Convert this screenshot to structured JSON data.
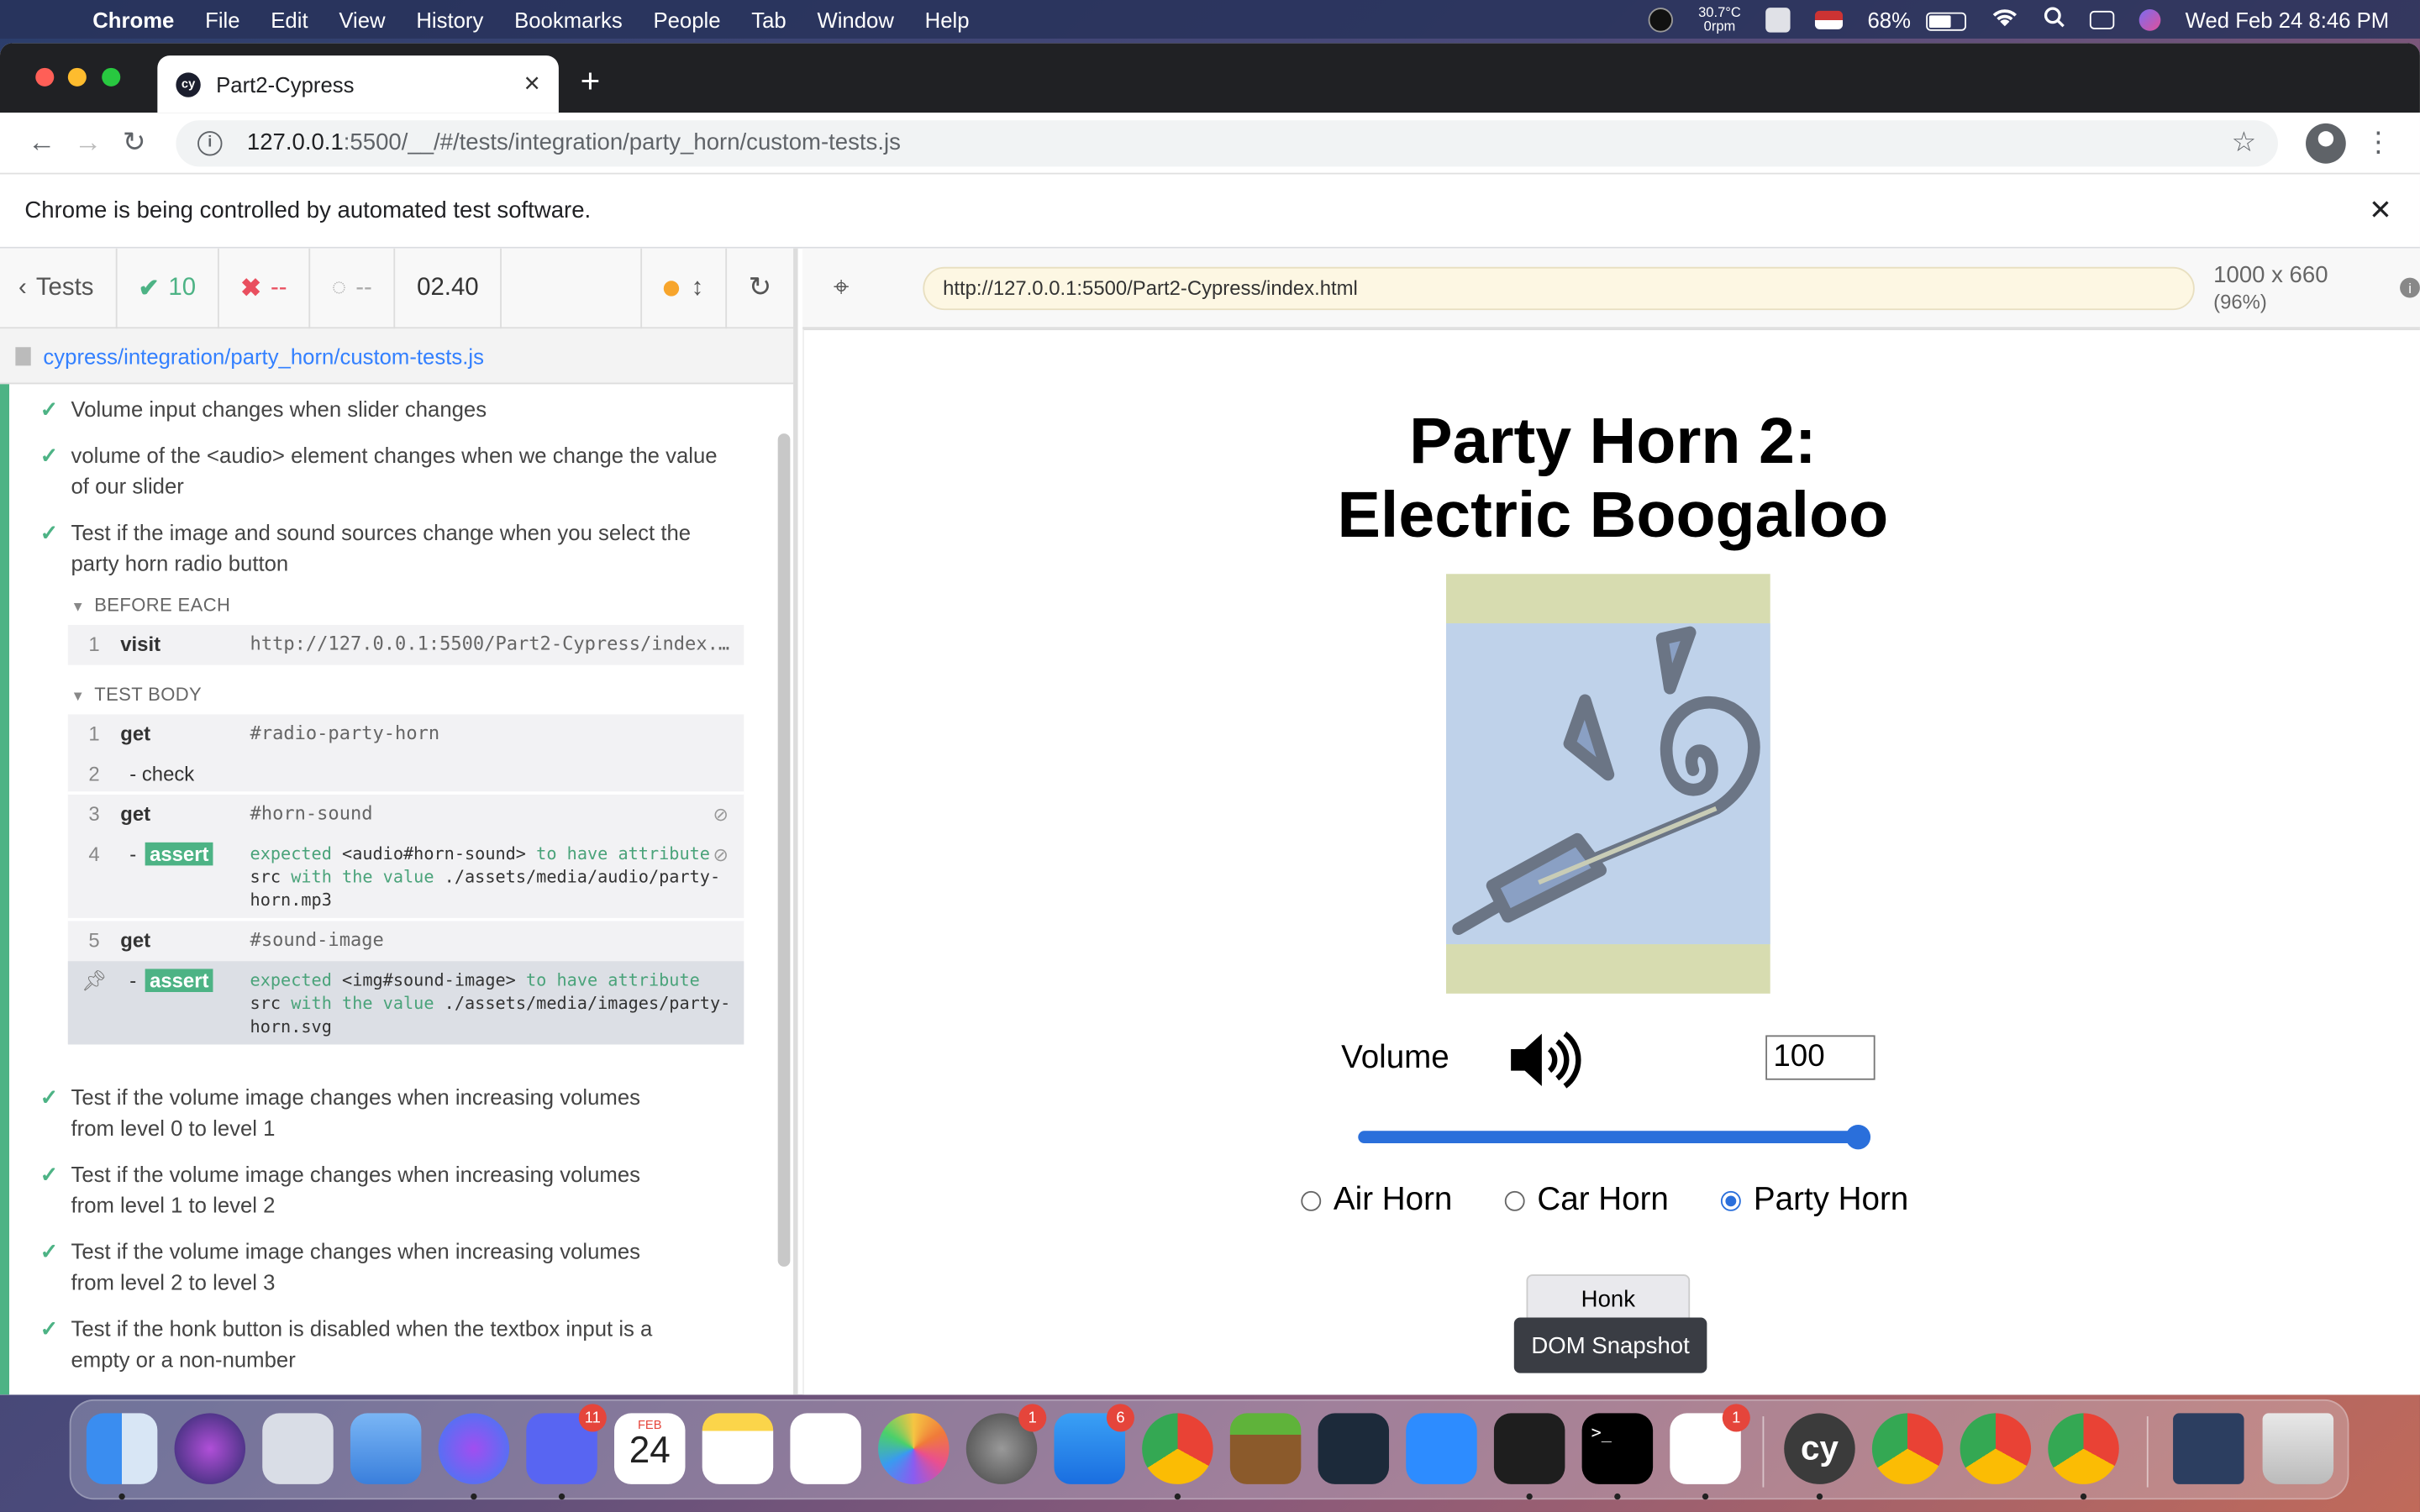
{
  "menubar": {
    "app": "Chrome",
    "items": [
      "File",
      "Edit",
      "View",
      "History",
      "Bookmarks",
      "People",
      "Tab",
      "Window",
      "Help"
    ],
    "temp": "30.7°C",
    "rpm": "0rpm",
    "battery": "68%",
    "battery_level": 0.68,
    "datetime": "Wed Feb 24  8:46 PM"
  },
  "browser": {
    "tab_title": "Part2-Cypress",
    "favicon_text": "cy",
    "url_host": "127.0.0.1",
    "url_rest": ":5500/__/#/tests/integration/party_horn/custom-tests.js",
    "infobar_text": "Chrome is being controlled by automated test software."
  },
  "cypress": {
    "back_label": "Tests",
    "passed": "10",
    "failed": "--",
    "pending": "--",
    "duration": "02.40",
    "spec_path": "cypress/integration/party_horn/custom-tests.js",
    "aut_url": "http://127.0.0.1:5500/Part2-Cypress/index.html",
    "viewport": "1000 x 660",
    "viewport_pct": "(96%)",
    "tests_before": [
      "Volume input changes when slider changes",
      "volume of the <audio> element changes when we change the value of our slider",
      "Test if the image and sound sources change when you select the party horn radio button"
    ],
    "before_each_label": "BEFORE EACH",
    "before_each_cmd": {
      "num": "1",
      "name": "visit",
      "msg": "http://127.0.0.1:5500/Part2-Cypress/index.html"
    },
    "test_body_label": "TEST BODY",
    "cmds": {
      "c1": {
        "num": "1",
        "name": "get",
        "msg": "#radio-party-horn"
      },
      "c2": {
        "num": "2",
        "name": "- check"
      },
      "c3": {
        "num": "3",
        "name": "get",
        "msg": "#horn-sound"
      },
      "c4": {
        "num": "4",
        "badge": "assert",
        "pre": "expected ",
        "subject": "<audio#horn-sound>",
        "mid": " to have attribute ",
        "attr": "src",
        "mid2": " with the value ",
        "value": "./assets/media/audio/party-horn.mp3"
      },
      "c5": {
        "num": "5",
        "name": "get",
        "msg": "#sound-image"
      },
      "c6": {
        "badge": "assert",
        "pre": "expected ",
        "subject": "<img#sound-image>",
        "mid": " to have attribute ",
        "attr": "src",
        "mid2": " with the value ",
        "value": "./assets/media/images/party-horn.svg"
      }
    },
    "tests_after": [
      "Test if the volume image changes when increasing volumes from level 0 to level 1",
      "Test if the volume image changes when increasing volumes from level 1 to level 2",
      "Test if the volume image changes when increasing volumes from level 2 to level 3",
      "Test if the honk button is disabled when the textbox input is a empty or a non-number"
    ]
  },
  "app": {
    "title_line1": "Party Horn 2:",
    "title_line2": "Electric Boogaloo",
    "volume_label": "Volume",
    "volume_value": "100",
    "slider_level": 1.0,
    "radios": [
      {
        "label": "Air Horn",
        "checked": false
      },
      {
        "label": "Car Horn",
        "checked": false
      },
      {
        "label": "Party Horn",
        "checked": true
      }
    ],
    "honk_label": "Honk",
    "dom_snapshot_label": "DOM Snapshot"
  },
  "dock": {
    "calendar_month": "FEB",
    "calendar_day": "24",
    "badges": {
      "discord": "11",
      "system_prefs": "1",
      "app_store": "6",
      "slack": "1"
    },
    "cypress_text": "cy"
  },
  "colors": {
    "cypress_green": "#4db385",
    "cypress_red": "#e94f5f",
    "link_blue": "#3380ff",
    "slider_blue": "#2a6fdb"
  }
}
